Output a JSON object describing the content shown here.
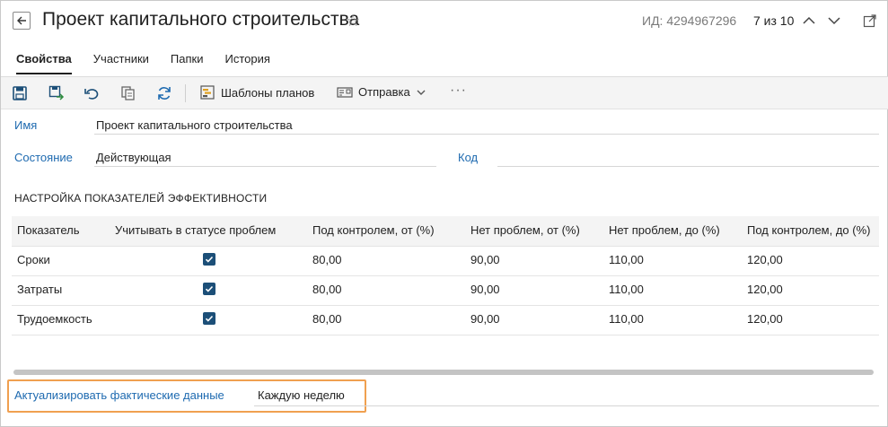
{
  "header": {
    "title": "Проект капитального строительства",
    "id_text": "ИД: 4294967296",
    "pager": "7 из 10"
  },
  "tabs": [
    {
      "label": "Свойства",
      "active": true
    },
    {
      "label": "Участники",
      "active": false
    },
    {
      "label": "Папки",
      "active": false
    },
    {
      "label": "История",
      "active": false
    }
  ],
  "toolbar": {
    "templates_label": "Шаблоны планов",
    "send_label": "Отправка",
    "more_label": "···"
  },
  "form": {
    "name_label": "Имя",
    "name_value": "Проект капитального строительства",
    "state_label": "Состояние",
    "state_value": "Действующая",
    "code_label": "Код",
    "code_value": ""
  },
  "kpi": {
    "section_title": "НАСТРОЙКА ПОКАЗАТЕЛЕЙ ЭФФЕКТИВНОСТИ",
    "columns": [
      "Показатель",
      "Учитывать в статусе проблем",
      "Под контролем, от (%)",
      "Нет проблем, от (%)",
      "Нет проблем, до (%)",
      "Под контролем, до (%)"
    ],
    "rows": [
      {
        "name": "Сроки",
        "checked": true,
        "ctrl_from": "80,00",
        "ok_from": "90,00",
        "ok_to": "110,00",
        "ctrl_to": "120,00"
      },
      {
        "name": "Затраты",
        "checked": true,
        "ctrl_from": "80,00",
        "ok_from": "90,00",
        "ok_to": "110,00",
        "ctrl_to": "120,00"
      },
      {
        "name": "Трудоемкость",
        "checked": true,
        "ctrl_from": "80,00",
        "ok_from": "90,00",
        "ok_to": "110,00",
        "ctrl_to": "120,00"
      }
    ]
  },
  "actualize": {
    "label": "Актуализировать фактические данные",
    "value": "Каждую неделю"
  },
  "colors": {
    "link": "#1e6ab0",
    "checkbox": "#1c4f78",
    "highlight": "#f0a050"
  }
}
